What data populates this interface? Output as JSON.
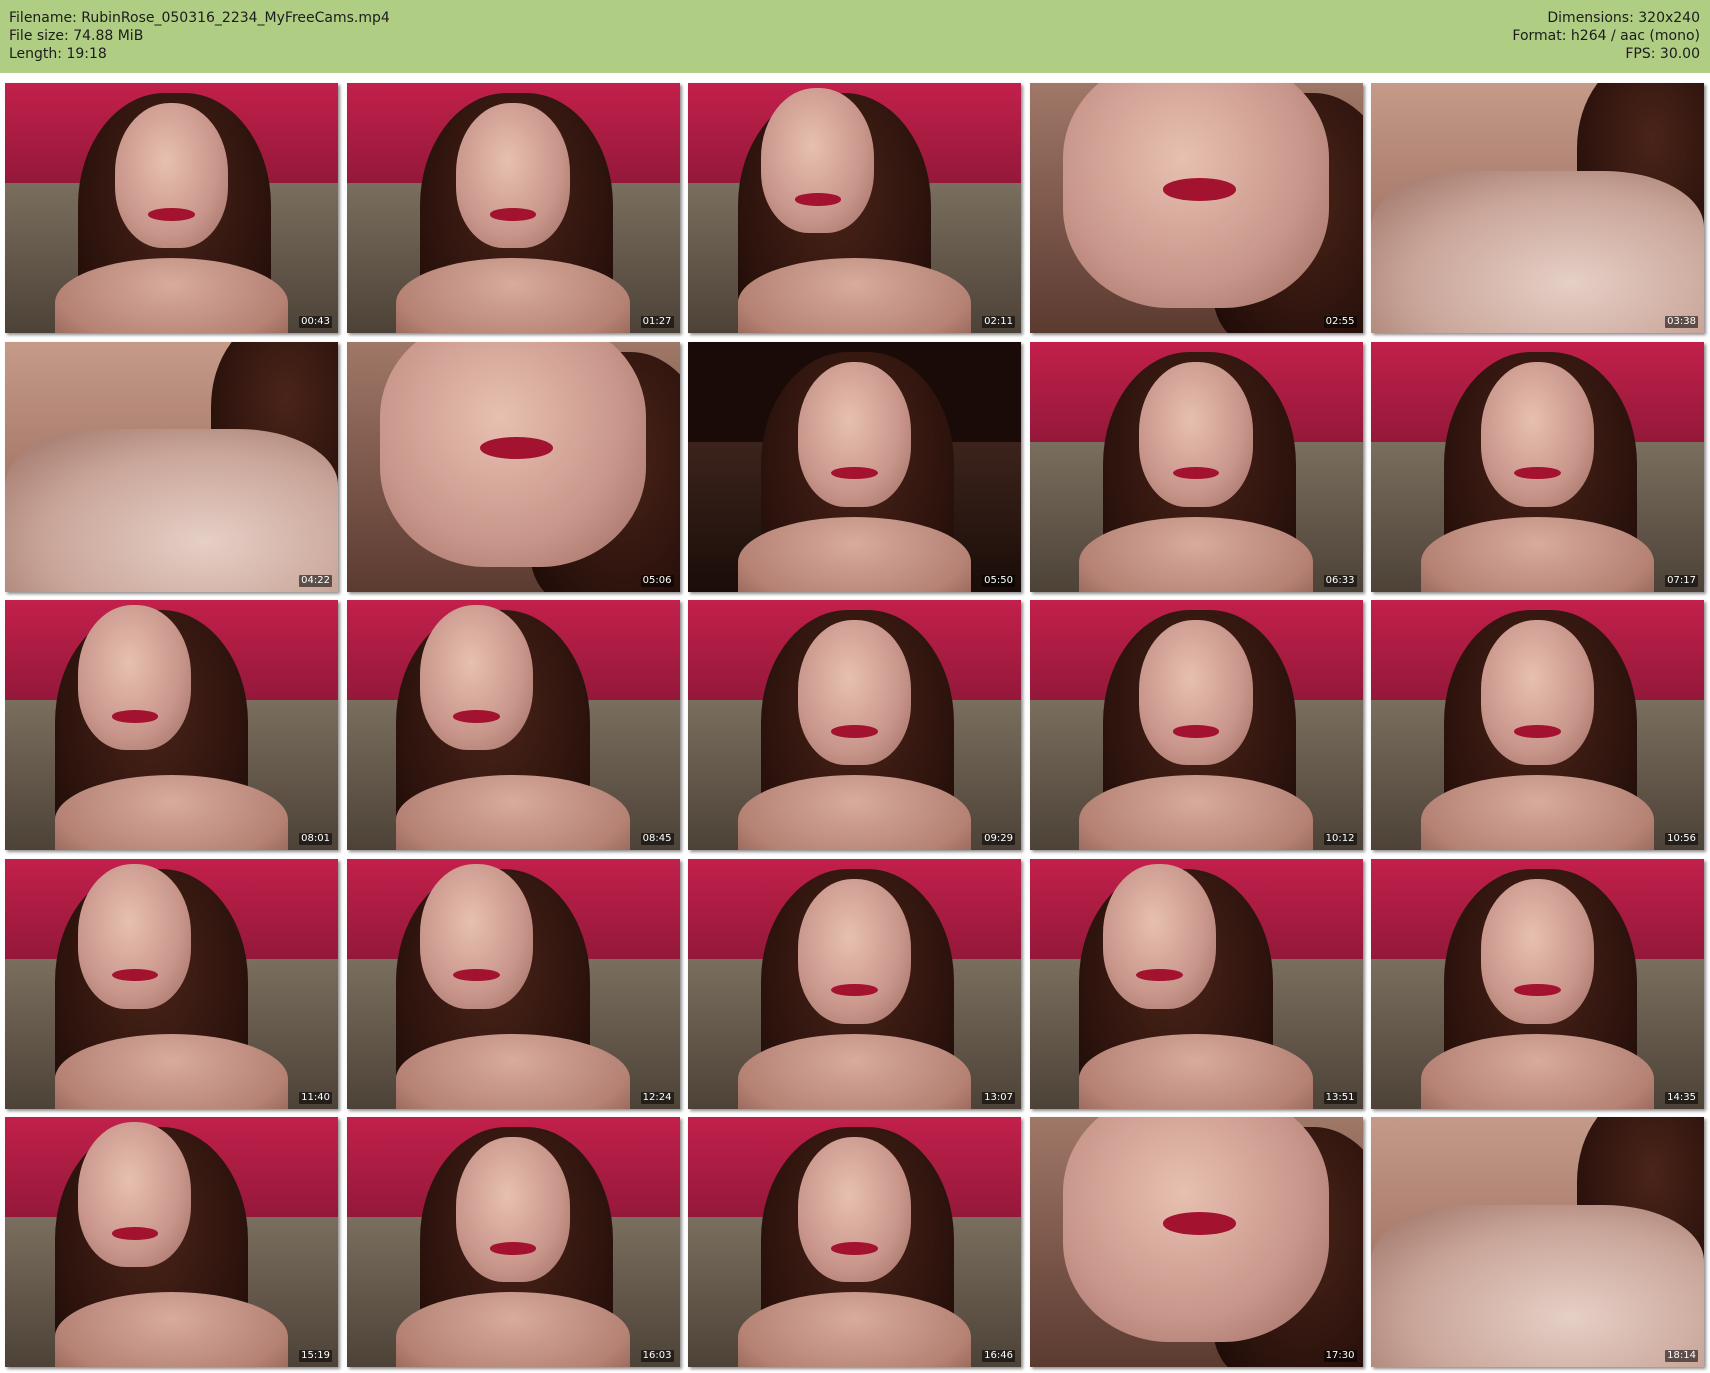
{
  "header": {
    "filename": "Filename: RubinRose_050316_2234_MyFreeCams.mp4",
    "filesize": "File size: 74.88 MiB",
    "length": "Length: 19:18",
    "dimensions": "Dimensions: 320x240",
    "format": "Format: h264 / aac (mono)",
    "fps": "FPS: 30.00"
  },
  "colors": {
    "header_bg": "#b0cd84",
    "page_bg": "#ffffff"
  },
  "thumbnails": [
    {
      "timestamp": "00:43",
      "style": "v-default"
    },
    {
      "timestamp": "01:27",
      "style": "v-default"
    },
    {
      "timestamp": "02:11",
      "style": "v-lean"
    },
    {
      "timestamp": "02:55",
      "style": "v-close"
    },
    {
      "timestamp": "03:38",
      "style": "v-chest"
    },
    {
      "timestamp": "04:22",
      "style": "v-chest"
    },
    {
      "timestamp": "05:06",
      "style": "v-close"
    },
    {
      "timestamp": "05:50",
      "style": "v-dark"
    },
    {
      "timestamp": "06:33",
      "style": "v-default"
    },
    {
      "timestamp": "07:17",
      "style": "v-default"
    },
    {
      "timestamp": "08:01",
      "style": "v-lean"
    },
    {
      "timestamp": "08:45",
      "style": "v-lean"
    },
    {
      "timestamp": "09:29",
      "style": "v-default"
    },
    {
      "timestamp": "10:12",
      "style": "v-default"
    },
    {
      "timestamp": "10:56",
      "style": "v-default"
    },
    {
      "timestamp": "11:40",
      "style": "v-lean"
    },
    {
      "timestamp": "12:24",
      "style": "v-lean"
    },
    {
      "timestamp": "13:07",
      "style": "v-default"
    },
    {
      "timestamp": "13:51",
      "style": "v-lean"
    },
    {
      "timestamp": "14:35",
      "style": "v-default"
    },
    {
      "timestamp": "15:19",
      "style": "v-lean"
    },
    {
      "timestamp": "16:03",
      "style": "v-default"
    },
    {
      "timestamp": "16:46",
      "style": "v-default"
    },
    {
      "timestamp": "17:30",
      "style": "v-close"
    },
    {
      "timestamp": "18:14",
      "style": "v-chest"
    }
  ]
}
